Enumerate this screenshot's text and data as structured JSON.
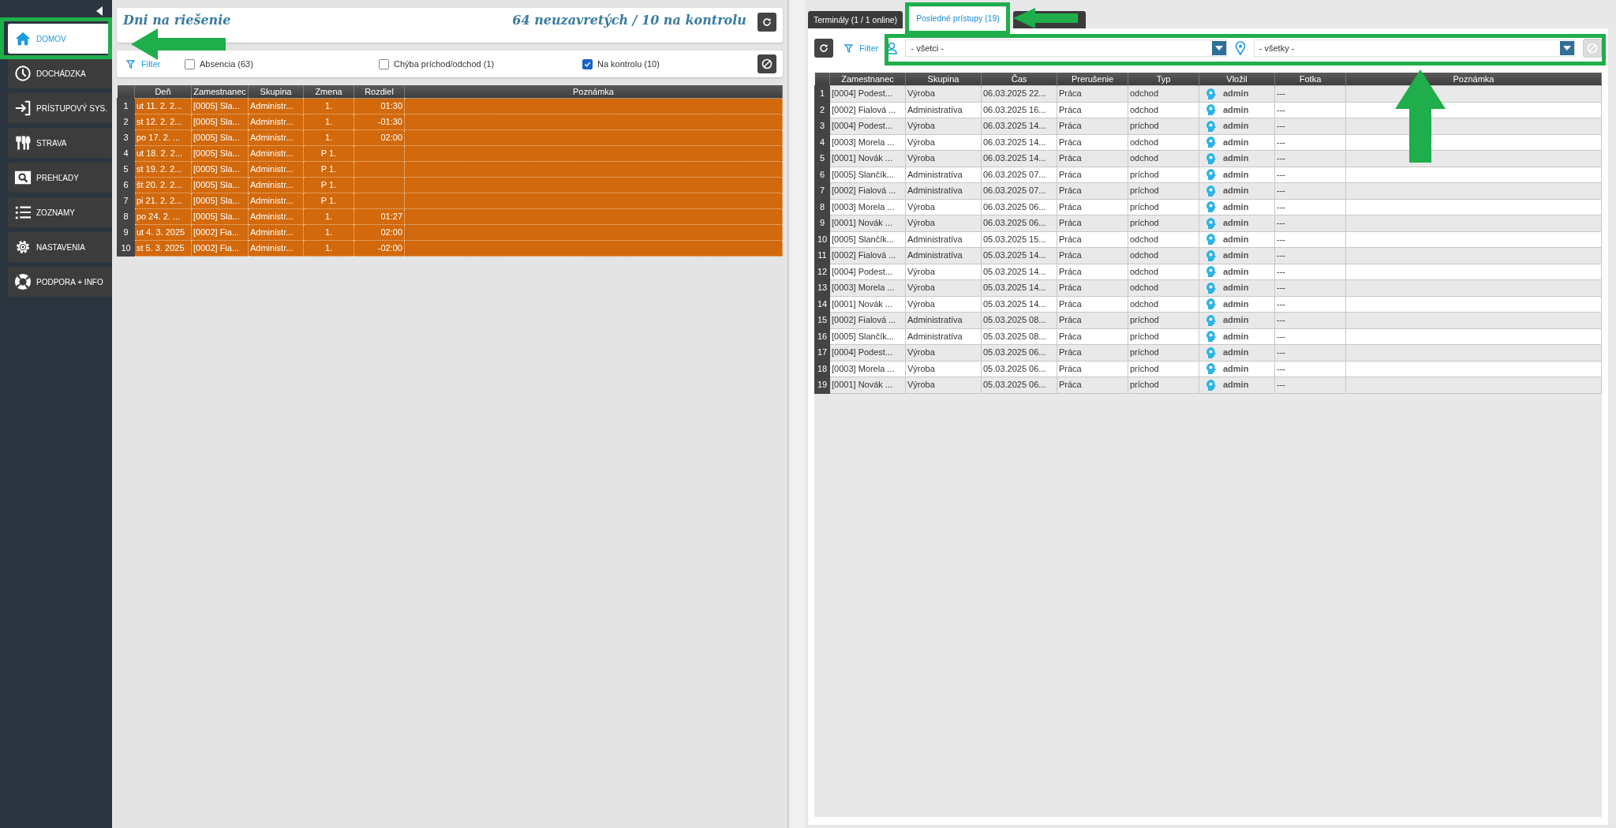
{
  "sidebar": {
    "items": [
      {
        "label": "DOMOV",
        "selected": true
      },
      {
        "label": "DOCHÁDZKA",
        "selected": false
      },
      {
        "label": "PRÍSTUPOVÝ SYS.",
        "selected": false
      },
      {
        "label": "STRAVA",
        "selected": false
      },
      {
        "label": "PREHĽADY",
        "selected": false
      },
      {
        "label": "ZOZNAMY",
        "selected": false
      },
      {
        "label": "NASTAVENIA",
        "selected": false
      },
      {
        "label": "PODPORA + INFO",
        "selected": false
      }
    ]
  },
  "left_panel": {
    "title": "Dni na riešenie",
    "summary": "64 neuzavretých / 10 na kontrolu",
    "filter_label": "Filter",
    "filters": [
      {
        "label": "Absencia (63)",
        "checked": false
      },
      {
        "label": "Chýba príchod/odchod (1)",
        "checked": false
      },
      {
        "label": "Na kontrolu (10)",
        "checked": true
      }
    ],
    "table": {
      "columns": [
        "",
        "Deň",
        "Zamestnanec",
        "Skupina",
        "Zmena",
        "Rozdiel",
        "Poznámka"
      ],
      "rows": [
        [
          "1",
          "ut 11. 2. 2...",
          "[0005] Sla...",
          "Administr...",
          "1.",
          "01:30"
        ],
        [
          "2",
          "st 12. 2. 2...",
          "[0005] Sla...",
          "Administr...",
          "1.",
          "-01:30"
        ],
        [
          "3",
          "po 17. 2. ...",
          "[0005] Sla...",
          "Administr...",
          "1.",
          "02:00"
        ],
        [
          "4",
          "ut 18. 2. 2...",
          "[0005] Sla...",
          "Administr...",
          "P 1."
        ],
        [
          "5",
          "st 19. 2. 2...",
          "[0005] Sla...",
          "Administr...",
          "P 1."
        ],
        [
          "6",
          "št 20. 2. 2...",
          "[0005] Sla...",
          "Administr...",
          "P 1."
        ],
        [
          "7",
          "pi 21. 2. 2...",
          "[0005] Sla...",
          "Administr...",
          "P 1."
        ],
        [
          "8",
          "po 24. 2. ...",
          "[0005] Sla...",
          "Administr...",
          "1.",
          "01:27"
        ],
        [
          "9",
          "ut 4. 3. 2025",
          "[0002] Fia...",
          "Administr...",
          "1.",
          "02:00"
        ],
        [
          "10",
          "st 5. 3. 2025",
          "[0002] Fia...",
          "Administr...",
          "1.",
          "-02:00"
        ]
      ]
    }
  },
  "right_panel": {
    "tabs": [
      {
        "label": "Terminály (1 / 1 online)",
        "selected": false
      },
      {
        "label": "Posledné prístupy (19)",
        "selected": true
      },
      {
        "selected": false
      }
    ],
    "filter_label": "Filter",
    "employee_select": "- všetci -",
    "location_select": "- všetky -",
    "table": {
      "columns": [
        "",
        "Zamestnanec",
        "Skupina",
        "Čas",
        "Prerušenie",
        "Typ",
        "Vložil",
        "Fotka",
        "Poznámka"
      ],
      "rows": [
        [
          "1",
          "[0004] Podest...",
          "Výroba",
          "06.03.2025 22...",
          "Práca",
          "odchod",
          "admin",
          "---"
        ],
        [
          "2",
          "[0002] Fialová ...",
          "Administratíva",
          "06.03.2025 16...",
          "Práca",
          "odchod",
          "admin",
          "---"
        ],
        [
          "3",
          "[0004] Podest...",
          "Výroba",
          "06.03.2025 14...",
          "Práca",
          "príchod",
          "admin",
          "---"
        ],
        [
          "4",
          "[0003] Morela ...",
          "Výroba",
          "06.03.2025 14...",
          "Práca",
          "odchod",
          "admin",
          "---"
        ],
        [
          "5",
          "[0001] Novák ...",
          "Výroba",
          "06.03.2025 14...",
          "Práca",
          "odchod",
          "admin",
          "---"
        ],
        [
          "6",
          "[0005] Slančík...",
          "Administratíva",
          "06.03.2025 07...",
          "Práca",
          "príchod",
          "admin",
          "---"
        ],
        [
          "7",
          "[0002] Fialová ...",
          "Administratíva",
          "06.03.2025 07...",
          "Práca",
          "príchod",
          "admin",
          "---"
        ],
        [
          "8",
          "[0003] Morela ...",
          "Výroba",
          "06.03.2025 06...",
          "Práca",
          "príchod",
          "admin",
          "---"
        ],
        [
          "9",
          "[0001] Novák ...",
          "Výroba",
          "06.03.2025 06...",
          "Práca",
          "príchod",
          "admin",
          "---"
        ],
        [
          "10",
          "[0005] Slančík...",
          "Administratíva",
          "05.03.2025 15...",
          "Práca",
          "odchod",
          "admin",
          "---"
        ],
        [
          "11",
          "[0002] Fialová ...",
          "Administratíva",
          "05.03.2025 14...",
          "Práca",
          "odchod",
          "admin",
          "---"
        ],
        [
          "12",
          "[0004] Podest...",
          "Výroba",
          "05.03.2025 14...",
          "Práca",
          "odchod",
          "admin",
          "---"
        ],
        [
          "13",
          "[0003] Morela ...",
          "Výroba",
          "05.03.2025 14...",
          "Práca",
          "odchod",
          "admin",
          "---"
        ],
        [
          "14",
          "[0001] Novák ...",
          "Výroba",
          "05.03.2025 14...",
          "Práca",
          "odchod",
          "admin",
          "---"
        ],
        [
          "15",
          "[0002] Fialová ...",
          "Administratíva",
          "05.03.2025 08...",
          "Práca",
          "príchod",
          "admin",
          "---"
        ],
        [
          "16",
          "[0005] Slančík...",
          "Administratíva",
          "05.03.2025 08...",
          "Práca",
          "príchod",
          "admin",
          "---"
        ],
        [
          "17",
          "[0004] Podest...",
          "Výroba",
          "05.03.2025 06...",
          "Práca",
          "príchod",
          "admin",
          "---"
        ],
        [
          "18",
          "[0003] Morela ...",
          "Výroba",
          "05.03.2025 06...",
          "Práca",
          "príchod",
          "admin",
          "---"
        ],
        [
          "19",
          "[0001] Novák ...",
          "Výroba",
          "05.03.2025 06...",
          "Práca",
          "príchod",
          "admin",
          "---"
        ]
      ]
    }
  }
}
